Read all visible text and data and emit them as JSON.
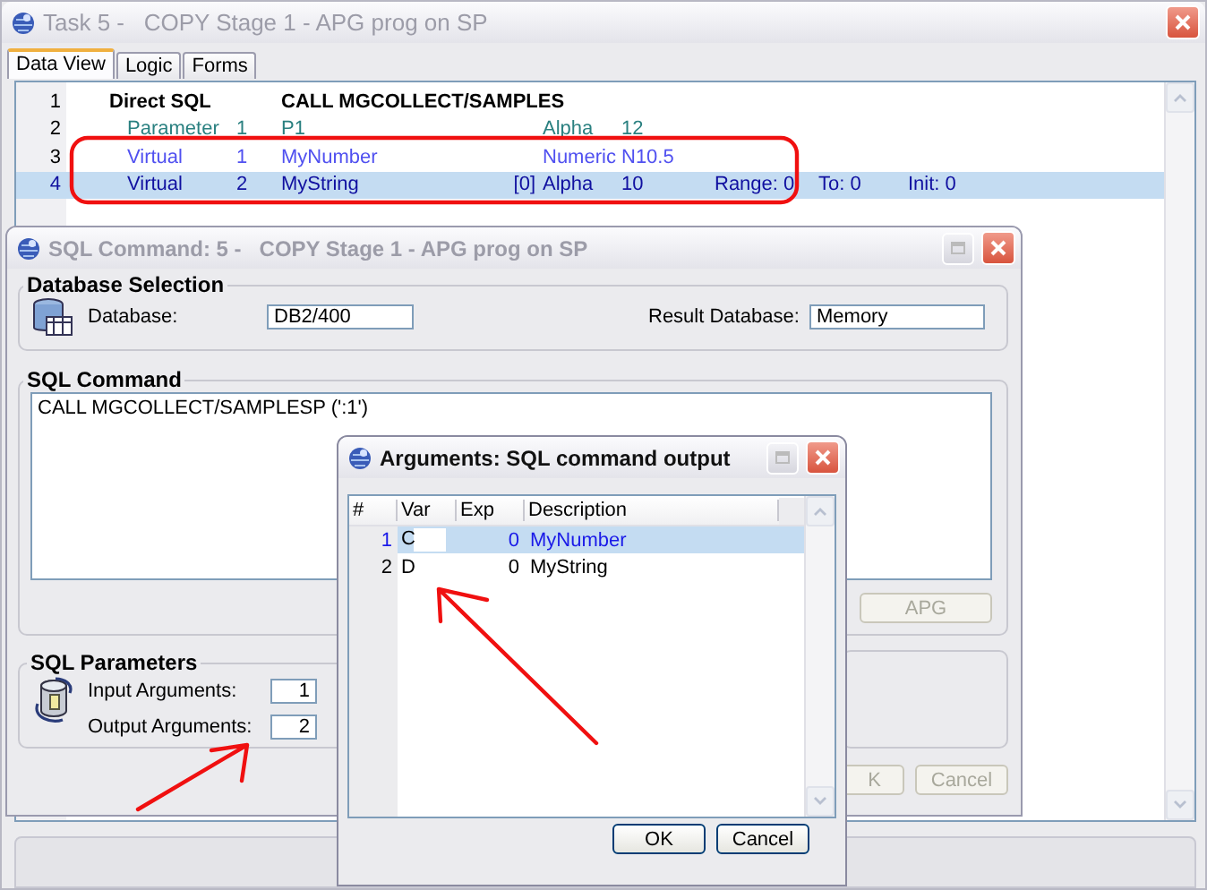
{
  "main_window": {
    "title": "Task 5 -   COPY Stage 1 - APG prog on SP",
    "active": false
  },
  "tabs": [
    {
      "label": "Data View",
      "selected": true
    },
    {
      "label": "Logic",
      "selected": false
    },
    {
      "label": "Forms",
      "selected": false
    }
  ],
  "data_view": {
    "rows": [
      {
        "kind": "operation",
        "number": "1",
        "name": "Direct SQL",
        "detail": "CALL MGCOLLECT/SAMPLES",
        "selected": false
      },
      {
        "kind": "parameter",
        "number": "2",
        "type": "Parameter",
        "index": "1",
        "name": "P1",
        "attribute": "Alpha",
        "size": "12",
        "selected": false
      },
      {
        "kind": "virtual",
        "number": "3",
        "type": "Virtual",
        "index": "1",
        "name": "MyNumber",
        "attribute": "Numeric",
        "size": "N10.5",
        "selected": false
      },
      {
        "kind": "virtual",
        "number": "4",
        "type": "Virtual",
        "index": "2",
        "name": "MyString",
        "dimension": "[0]",
        "attribute": "Alpha",
        "size": "10",
        "range": "Range:  0",
        "to": "To:  0",
        "init": "Init:   0",
        "selected": true
      }
    ]
  },
  "sql_command_window": {
    "title": "SQL Command: 5 -   COPY Stage 1 - APG prog on SP",
    "active": false,
    "database_selection": {
      "heading": "Database Selection",
      "database_label": "Database:",
      "database": "DB2/400",
      "result_label": "Result Database:",
      "result_database": "Memory"
    },
    "sql_command": {
      "heading": "SQL Command",
      "text": "CALL MGCOLLECT/SAMPLESP (':1')",
      "apg_button": {
        "label": "APG",
        "disabled": true
      }
    },
    "sql_parameters": {
      "heading": "SQL Parameters",
      "input_label": "Input Arguments:",
      "input": "1",
      "output_label": "Output Arguments:",
      "output": "2"
    },
    "buttons": [
      {
        "label": "K",
        "disabled": true
      },
      {
        "label": "Cancel",
        "disabled": true
      }
    ]
  },
  "arguments_window": {
    "title": "Arguments: SQL command output",
    "active": true,
    "columns": [
      "#",
      "Var",
      "Exp",
      "Description"
    ],
    "rows": [
      {
        "number": "1",
        "var": "C",
        "exp": "0",
        "description": "MyNumber",
        "selected": true,
        "editing": true
      },
      {
        "number": "2",
        "var": "D",
        "exp": "0",
        "description": "MyString",
        "selected": false,
        "editing": false
      }
    ],
    "buttons": [
      {
        "label": "OK",
        "disabled": false
      },
      {
        "label": "Cancel",
        "disabled": false
      }
    ]
  }
}
